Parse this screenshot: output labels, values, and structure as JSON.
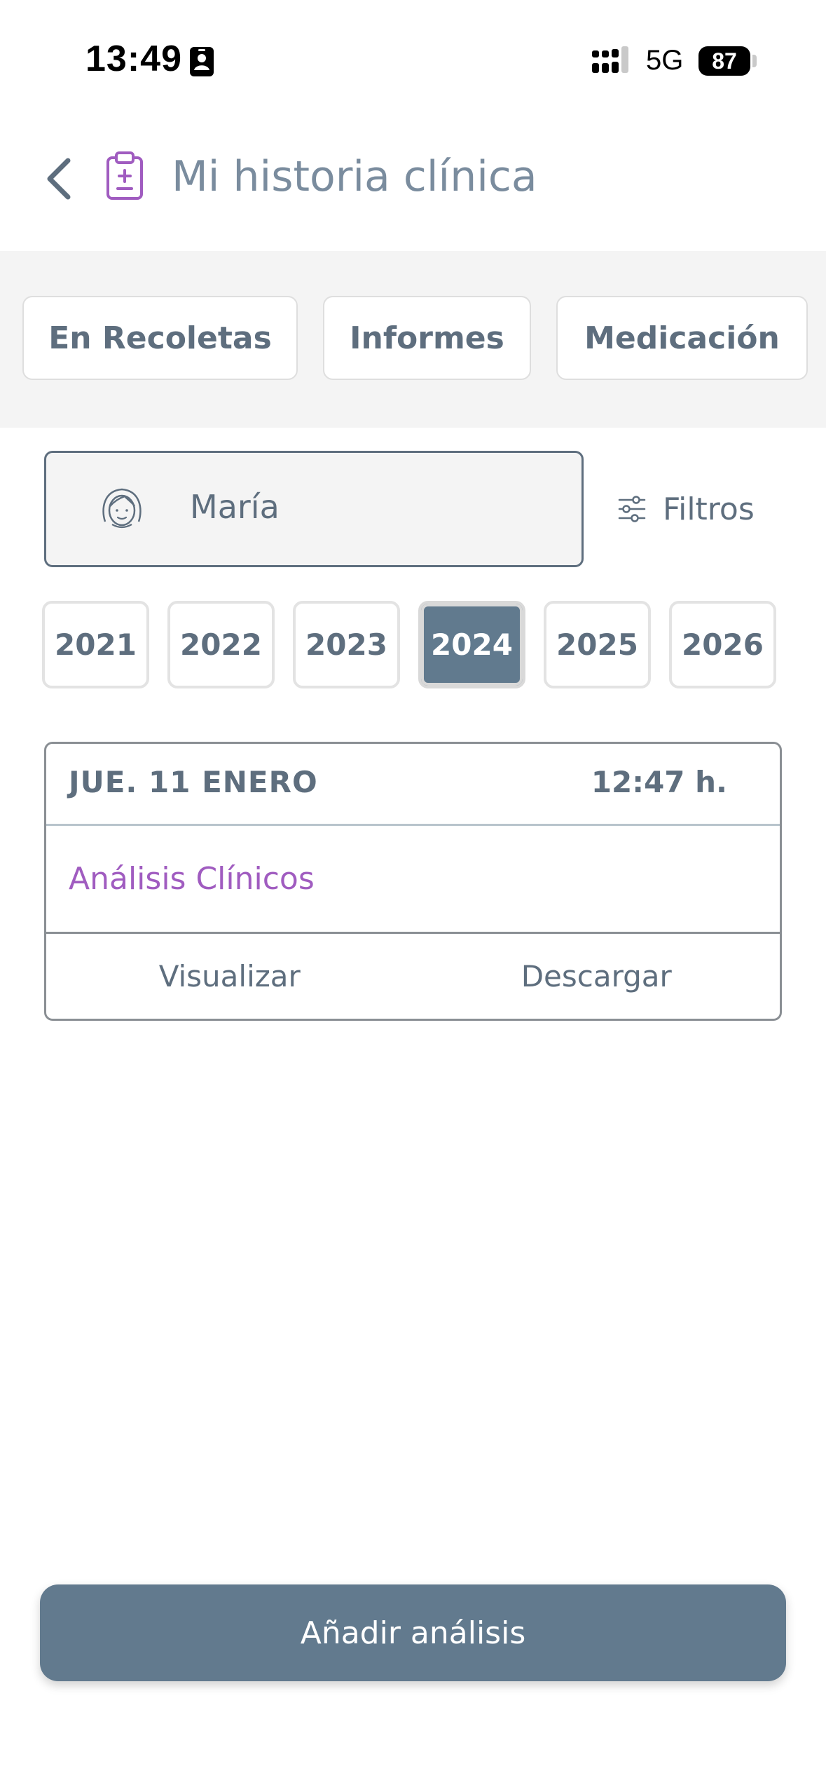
{
  "status_bar": {
    "time": "13:49",
    "network": "5G",
    "battery": "87"
  },
  "header": {
    "title": "Mi historia clínica",
    "accent_color": "#a05cc0"
  },
  "tabs": [
    {
      "label": "En Recoletas"
    },
    {
      "label": "Informes"
    },
    {
      "label": "Medicación"
    }
  ],
  "patient": {
    "name": "María"
  },
  "filters": {
    "label": "Filtros"
  },
  "years": {
    "items": [
      "2021",
      "2022",
      "2023",
      "2024",
      "2025",
      "2026"
    ],
    "selected": "2024"
  },
  "record": {
    "date": "JUE. 11 ENERO",
    "time": "12:47 h.",
    "type": "Análisis Clínicos",
    "view_label": "Visualizar",
    "download_label": "Descargar"
  },
  "footer": {
    "add_button_label": "Añadir análisis",
    "button_color": "#627a8e"
  }
}
